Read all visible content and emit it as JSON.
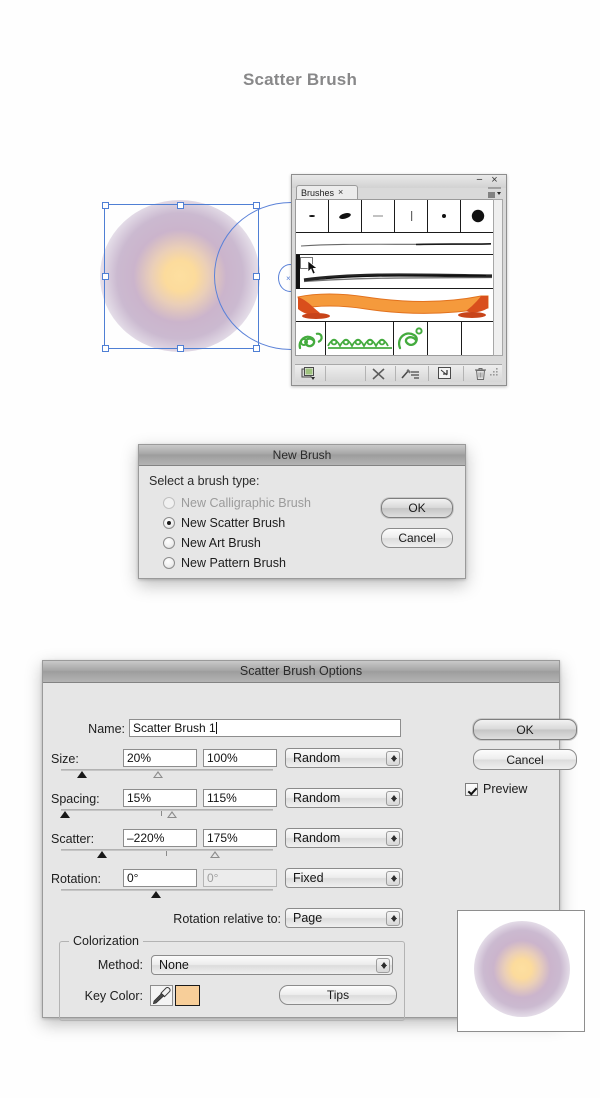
{
  "page": {
    "title": "Scatter Brush"
  },
  "brushes_panel": {
    "tab_label": "Brushes",
    "tab_close_icon": "close-icon",
    "minimize_icon": "minimize-icon",
    "close_icon": "close-icon",
    "menu_icon": "panel-menu-icon",
    "rows": [
      {
        "type": "calligraphic-row",
        "cells": [
          "brush-3pt-round",
          "brush-oval",
          "brush-dash",
          "brush-vertical",
          "brush-small-dot",
          "brush-large-dot"
        ]
      },
      {
        "type": "art-brush-thin-stroke"
      },
      {
        "type": "art-brush-charcoal",
        "selected": true
      },
      {
        "type": "art-brush-orange-banner"
      },
      {
        "type": "pattern-brush-green-floral"
      }
    ],
    "footer_icons": [
      "brush-libraries-icon",
      "remove-brush-link-icon",
      "options-of-object-icon",
      "new-brush-icon",
      "delete-brush-icon"
    ]
  },
  "artwork": {
    "selection": "ellipse-selection",
    "drag_ghost": "drag-ghost-ellipse"
  },
  "new_brush_dialog": {
    "title": "New Brush",
    "prompt": "Select a brush type:",
    "options": [
      {
        "label": "New Calligraphic Brush",
        "checked": false,
        "disabled": true
      },
      {
        "label": "New Scatter Brush",
        "checked": true,
        "disabled": false
      },
      {
        "label": "New Art Brush",
        "checked": false,
        "disabled": false
      },
      {
        "label": "New Pattern Brush",
        "checked": false,
        "disabled": false
      }
    ],
    "ok_label": "OK",
    "cancel_label": "Cancel"
  },
  "scatter_brush_options": {
    "title": "Scatter Brush Options",
    "name_label": "Name:",
    "name_value": "Scatter Brush 1",
    "rows": [
      {
        "label": "Size:",
        "min_value": "20%",
        "max_value": "100%",
        "mode": "Random",
        "min_enabled": true,
        "max_enabled": true
      },
      {
        "label": "Spacing:",
        "min_value": "15%",
        "max_value": "115%",
        "mode": "Random",
        "min_enabled": true,
        "max_enabled": true
      },
      {
        "label": "Scatter:",
        "min_value": "–220%",
        "max_value": "175%",
        "mode": "Random",
        "min_enabled": true,
        "max_enabled": true
      },
      {
        "label": "Rotation:",
        "min_value": "0°",
        "max_value": "0°",
        "mode": "Fixed",
        "min_enabled": true,
        "max_enabled": false
      }
    ],
    "rotation_relative_label": "Rotation relative to:",
    "rotation_relative_value": "Page",
    "colorization_legend": "Colorization",
    "method_label": "Method:",
    "method_value": "None",
    "key_color_label": "Key Color:",
    "key_color_hex": "#f7ce99",
    "eyedropper_icon": "eyedropper-icon",
    "tips_label": "Tips",
    "ok_label": "OK",
    "cancel_label": "Cancel",
    "preview_label": "Preview",
    "preview_checked": true,
    "preview_thumbnail": "scatter-brush-preview"
  }
}
